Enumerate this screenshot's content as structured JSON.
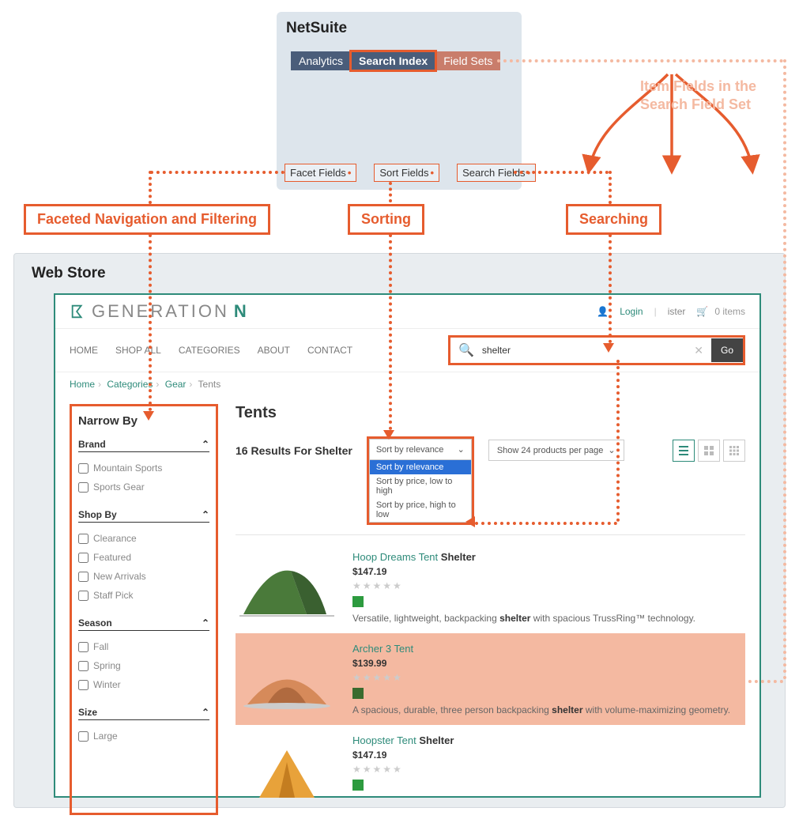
{
  "netsuite": {
    "title": "NetSuite",
    "tabs": {
      "analytics": "Analytics",
      "search_index": "Search Index",
      "field_sets": "Field Sets"
    },
    "subtabs": {
      "facet": "Facet Fields",
      "sort": "Sort Fields",
      "search": "Search Fields"
    }
  },
  "callouts": {
    "faceted": "Faceted Navigation and Filtering",
    "sorting": "Sorting",
    "searching": "Searching",
    "fieldsets": "Item Fields in the\nSearch Field Set"
  },
  "webstore": {
    "title": "Web Store",
    "logo": "GENERATION",
    "logo_n": "N",
    "toplinks": {
      "login": "Login",
      "register_frag": "ister",
      "cart": "0 items"
    },
    "nav": [
      "HOME",
      "SHOP ALL",
      "CATEGORIES",
      "ABOUT",
      "CONTACT"
    ],
    "search": {
      "value": "shelter",
      "go": "Go"
    },
    "breadcrumbs": [
      "Home",
      "Categories",
      "Gear",
      "Tents"
    ],
    "narrow_title": "Narrow By",
    "facets": [
      {
        "name": "Brand",
        "options": [
          "Mountain Sports",
          "Sports Gear"
        ]
      },
      {
        "name": "Shop By",
        "options": [
          "Clearance",
          "Featured",
          "New Arrivals",
          "Staff Pick"
        ]
      },
      {
        "name": "Season",
        "options": [
          "Fall",
          "Spring",
          "Winter"
        ]
      },
      {
        "name": "Size",
        "options": [
          "Large"
        ]
      }
    ],
    "results": {
      "heading": "Tents",
      "count_text": "16 Results For Shelter",
      "sort": {
        "label": "Sort by relevance",
        "options": [
          "Sort by relevance",
          "Sort by price, low to high",
          "Sort by price, high to low"
        ]
      },
      "perpage": "Show 24 products per page",
      "products": [
        {
          "name": "Hoop Dreams Tent",
          "hl": "Shelter",
          "price": "$147.19",
          "desc_pre": "Versatile, lightweight, backpacking ",
          "desc_hl": "shelter",
          "desc_post": " with spacious TrussRing™ technology.",
          "color": "green"
        },
        {
          "name": "Archer 3 Tent",
          "hl": "",
          "price": "$139.99",
          "desc_pre": "A spacious, durable, three person backpacking ",
          "desc_hl": "shelter",
          "desc_post": " with volume-maximizing geometry.",
          "color": "orange"
        },
        {
          "name": "Hoopster Tent",
          "hl": "Shelter",
          "price": "$147.19",
          "desc_pre": "",
          "desc_hl": "",
          "desc_post": "",
          "color": "yellow"
        }
      ]
    }
  }
}
